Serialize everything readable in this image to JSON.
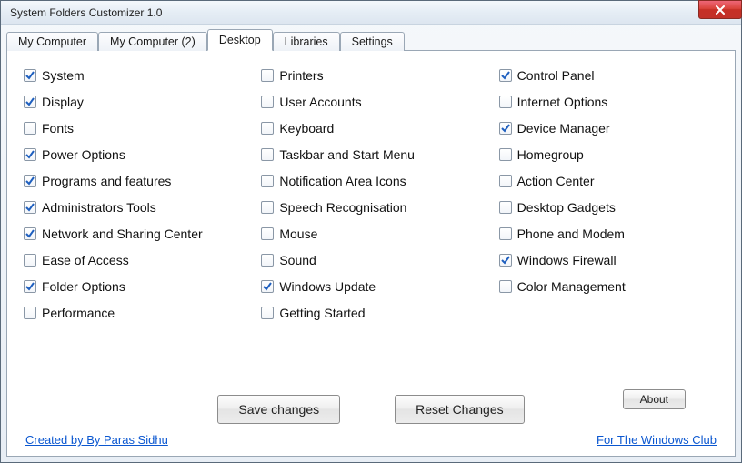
{
  "window": {
    "title": "System Folders Customizer 1.0"
  },
  "tabs": [
    {
      "label": "My Computer",
      "active": false
    },
    {
      "label": "My Computer (2)",
      "active": false
    },
    {
      "label": "Desktop",
      "active": true
    },
    {
      "label": "Libraries",
      "active": false
    },
    {
      "label": "Settings",
      "active": false
    }
  ],
  "columns": [
    [
      {
        "label": "System",
        "checked": true
      },
      {
        "label": "Display",
        "checked": true
      },
      {
        "label": "Fonts",
        "checked": false
      },
      {
        "label": "Power Options",
        "checked": true
      },
      {
        "label": "Programs and features",
        "checked": true
      },
      {
        "label": "Administrators Tools",
        "checked": true
      },
      {
        "label": "Network and Sharing Center",
        "checked": true
      },
      {
        "label": "Ease of Access",
        "checked": false
      },
      {
        "label": "Folder Options",
        "checked": true
      },
      {
        "label": "Performance",
        "checked": false
      }
    ],
    [
      {
        "label": "Printers",
        "checked": false
      },
      {
        "label": "User Accounts",
        "checked": false
      },
      {
        "label": "Keyboard",
        "checked": false
      },
      {
        "label": "Taskbar and Start Menu",
        "checked": false
      },
      {
        "label": "Notification Area Icons",
        "checked": false
      },
      {
        "label": "Speech Recognisation",
        "checked": false
      },
      {
        "label": "Mouse",
        "checked": false
      },
      {
        "label": "Sound",
        "checked": false
      },
      {
        "label": "Windows Update",
        "checked": true
      },
      {
        "label": "Getting Started",
        "checked": false
      }
    ],
    [
      {
        "label": "Control Panel",
        "checked": true
      },
      {
        "label": "Internet Options",
        "checked": false
      },
      {
        "label": "Device Manager",
        "checked": true
      },
      {
        "label": "Homegroup",
        "checked": false
      },
      {
        "label": "Action Center",
        "checked": false
      },
      {
        "label": "Desktop Gadgets",
        "checked": false
      },
      {
        "label": "Phone and Modem",
        "checked": false
      },
      {
        "label": "Windows Firewall",
        "checked": true
      },
      {
        "label": "Color Management",
        "checked": false
      }
    ]
  ],
  "buttons": {
    "save": "Save changes",
    "reset": "Reset Changes",
    "about": "About"
  },
  "footer": {
    "left": "Created by By Paras Sidhu",
    "right": "For The Windows Club"
  }
}
